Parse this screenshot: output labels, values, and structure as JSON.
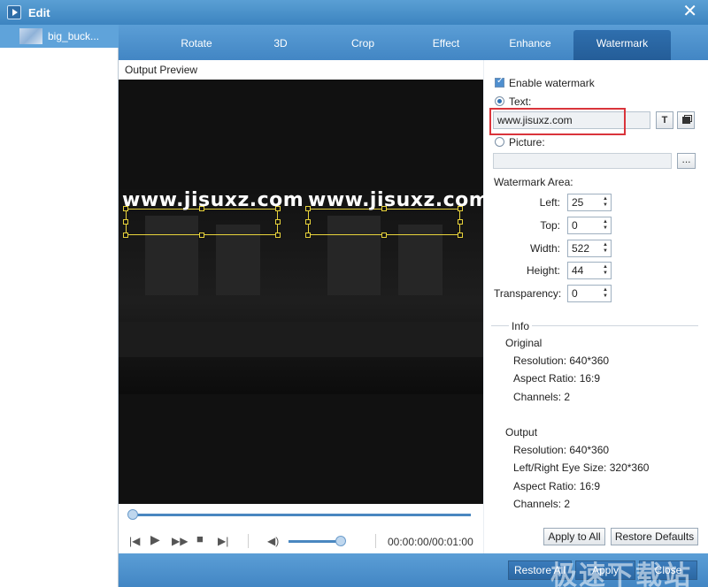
{
  "window": {
    "title": "Edit"
  },
  "files": [
    {
      "name": "big_buck..."
    }
  ],
  "tabs": [
    {
      "label": "Rotate",
      "active": false
    },
    {
      "label": "3D",
      "active": false
    },
    {
      "label": "Crop",
      "active": false
    },
    {
      "label": "Effect",
      "active": false
    },
    {
      "label": "Enhance",
      "active": false
    },
    {
      "label": "Watermark",
      "active": true
    }
  ],
  "preview": {
    "label": "Output Preview",
    "watermark_text": "www.jisuxz.com",
    "timecode": "00:00:00/00:01:00",
    "seek_progress": 0.0,
    "volume_level": 0.9
  },
  "watermark": {
    "enable_label": "Enable watermark",
    "enabled": true,
    "text_option_label": "Text:",
    "text_selected": true,
    "text_value": "www.jisuxz.com",
    "font_button_label": "T",
    "picture_option_label": "Picture:",
    "picture_path": "",
    "browse_label": "...",
    "area_label": "Watermark Area:",
    "left_label": "Left:",
    "left_value": "25",
    "top_label": "Top:",
    "top_value": "0",
    "width_label": "Width:",
    "width_value": "522",
    "height_label": "Height:",
    "height_value": "44",
    "transparency_label": "Transparency:",
    "transparency_value": "0"
  },
  "info": {
    "title": "Info",
    "original": {
      "heading": "Original",
      "resolution": "Resolution: 640*360",
      "aspect": "Aspect Ratio: 16:9",
      "channels": "Channels: 2"
    },
    "output": {
      "heading": "Output",
      "resolution": "Resolution: 640*360",
      "eye_size": "Left/Right Eye Size: 320*360",
      "aspect": "Aspect Ratio: 16:9",
      "channels": "Channels: 2"
    }
  },
  "buttons": {
    "apply_to_all": "Apply to All",
    "restore_defaults": "Restore Defaults",
    "restore_all": "Restore All",
    "apply": "Apply",
    "close": "Close"
  },
  "site_watermark": "极速下载站",
  "colors": {
    "accent": "#4286c4",
    "highlight_box": "#d9343b",
    "watermark_box": "#e8d33b"
  }
}
